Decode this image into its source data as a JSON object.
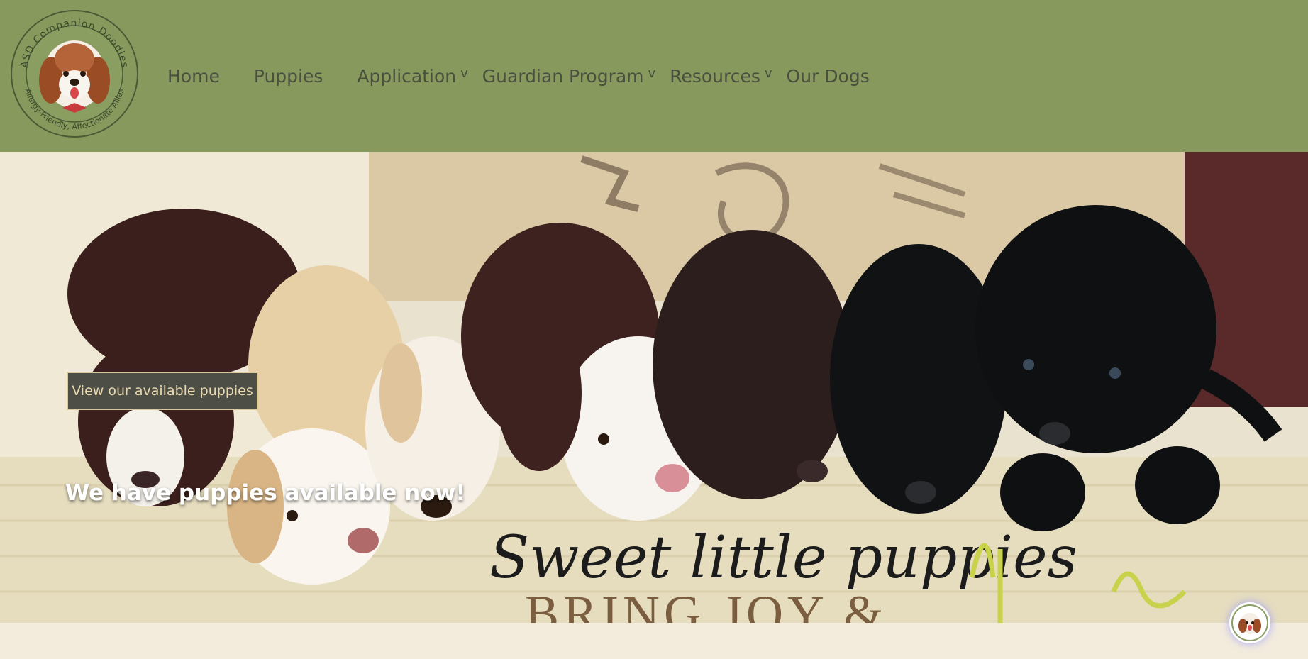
{
  "brand": {
    "logo_ring_text_top": "ASD Companion Doodles",
    "logo_ring_text_bottom": "Allergy-Friendly, Affectionate Allies"
  },
  "nav": {
    "items": [
      {
        "label": "Home",
        "has_dropdown": false
      },
      {
        "label": "Puppies",
        "has_dropdown": false
      },
      {
        "label": "Application",
        "has_dropdown": true
      },
      {
        "label": "Guardian Program",
        "has_dropdown": true
      },
      {
        "label": "Resources",
        "has_dropdown": true
      },
      {
        "label": "Our Dogs",
        "has_dropdown": false
      }
    ],
    "dropdown_glyph": "v"
  },
  "hero": {
    "headline": "We have puppies available now!",
    "cta_label": "View our available puppies",
    "script_line": "Sweet little puppies",
    "serif_line": "BRING JOY &"
  },
  "colors": {
    "header_bg": "#87995d",
    "nav_text": "#4a4f3e",
    "cta_bg": "#4d4f46",
    "cta_border": "#d8c998",
    "page_bg": "#f3ecdd"
  },
  "icons": {
    "dropdown": "chevron-down-icon",
    "chat": "chat-widget-icon"
  }
}
